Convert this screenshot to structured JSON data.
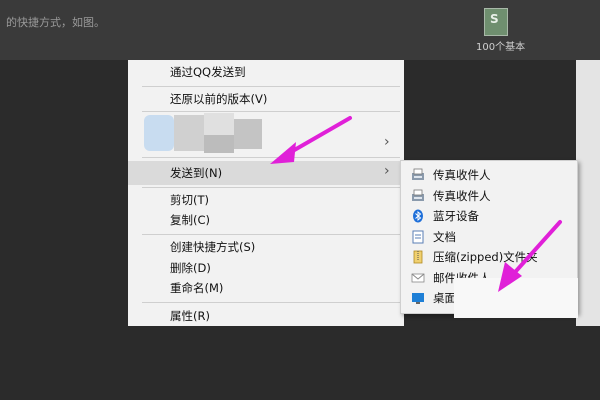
{
  "background": {
    "text_line": "的快捷方式，如图。",
    "desktop_icon_label": "100个基本"
  },
  "context_menu": {
    "items": [
      {
        "label": "通过QQ发送到"
      },
      {
        "label": "还原以前的版本(V)"
      },
      {
        "label": "发送到(N)"
      },
      {
        "label": "剪切(T)"
      },
      {
        "label": "复制(C)"
      },
      {
        "label": "创建快捷方式(S)"
      },
      {
        "label": "删除(D)"
      },
      {
        "label": "重命名(M)"
      },
      {
        "label": "属性(R)"
      }
    ]
  },
  "send_to_menu": {
    "items": [
      {
        "label": "传真收件人",
        "icon": "fax-icon"
      },
      {
        "label": "传真收件人",
        "icon": "fax-icon"
      },
      {
        "label": "蓝牙设备",
        "icon": "bluetooth-icon"
      },
      {
        "label": "文档",
        "icon": "document-icon"
      },
      {
        "label": "压缩(zipped)文件夹",
        "icon": "zip-folder-icon"
      },
      {
        "label": "邮件收件人",
        "icon": "mail-icon"
      },
      {
        "label": "桌面",
        "icon": "desktop-icon"
      }
    ]
  },
  "colors": {
    "annotation_arrow": "#e020d8",
    "menu_bg": "#f2f2f2",
    "highlight": "#dadada"
  }
}
